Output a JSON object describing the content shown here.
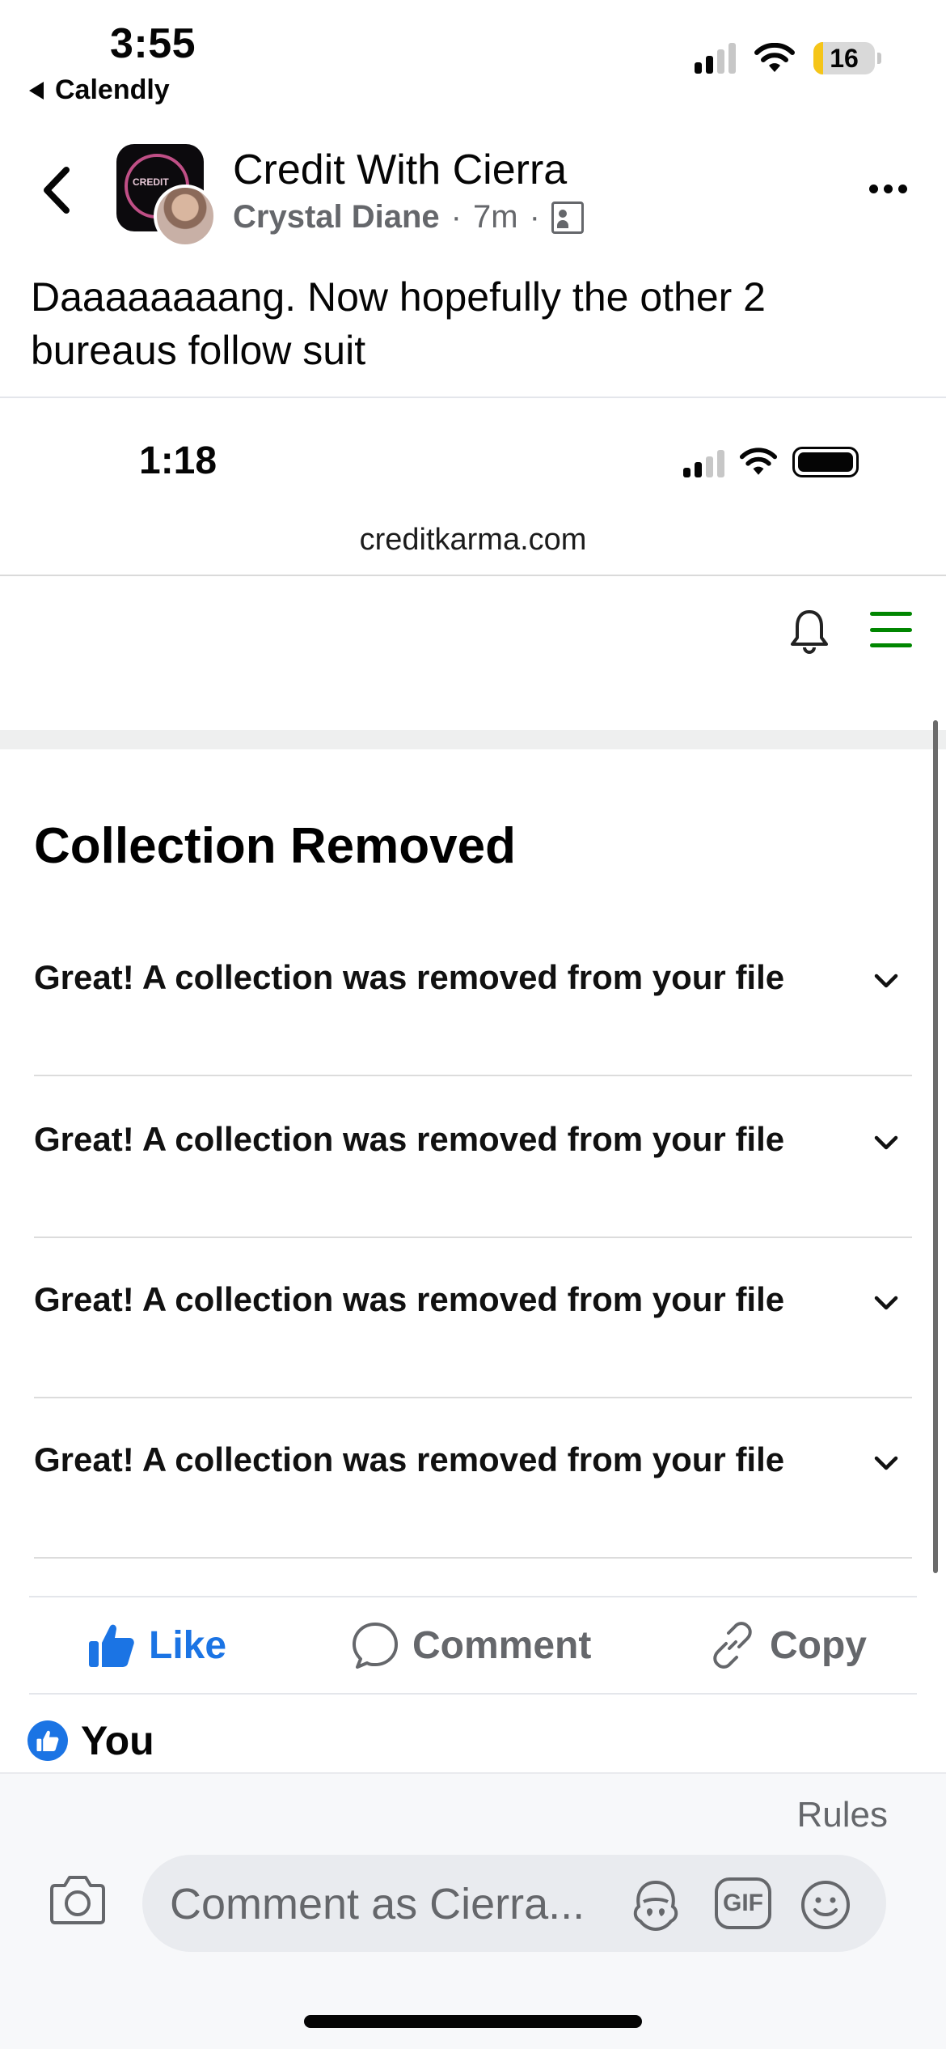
{
  "status_bar": {
    "time": "3:55",
    "back_app": "Calendly",
    "battery_level": "16"
  },
  "post": {
    "page_name": "Credit With Cierra",
    "author": "Crystal Diane",
    "separator": "·",
    "time_ago": "7m",
    "avatar_logo_text": "CREDIT",
    "text": "Daaaaaaaang. Now hopefully the other 2 bureaus follow suit"
  },
  "screenshot": {
    "time": "1:18",
    "url": "creditkarma.com",
    "title": "Collection Removed",
    "rows": [
      {
        "label": "Great! A collection was removed from your file"
      },
      {
        "label": "Great! A collection was removed from your file"
      },
      {
        "label": "Great! A collection was removed from your file"
      },
      {
        "label": "Great! A collection was removed from your file"
      }
    ],
    "accent_color": "#008600"
  },
  "actions": {
    "like": "Like",
    "comment": "Comment",
    "copy": "Copy",
    "like_color": "#1b74e4"
  },
  "reactions": {
    "who": "You"
  },
  "composer": {
    "rules": "Rules",
    "placeholder": "Comment as Cierra...",
    "gif": "GIF"
  },
  "icons": [
    "back-chevron-icon",
    "more-icon",
    "audience-icon",
    "bell-icon",
    "menu-icon",
    "chevron-down-icon",
    "like-icon",
    "comment-icon",
    "link-icon",
    "camera-icon",
    "avatar-sticker-icon",
    "gif-icon",
    "emoji-icon"
  ]
}
